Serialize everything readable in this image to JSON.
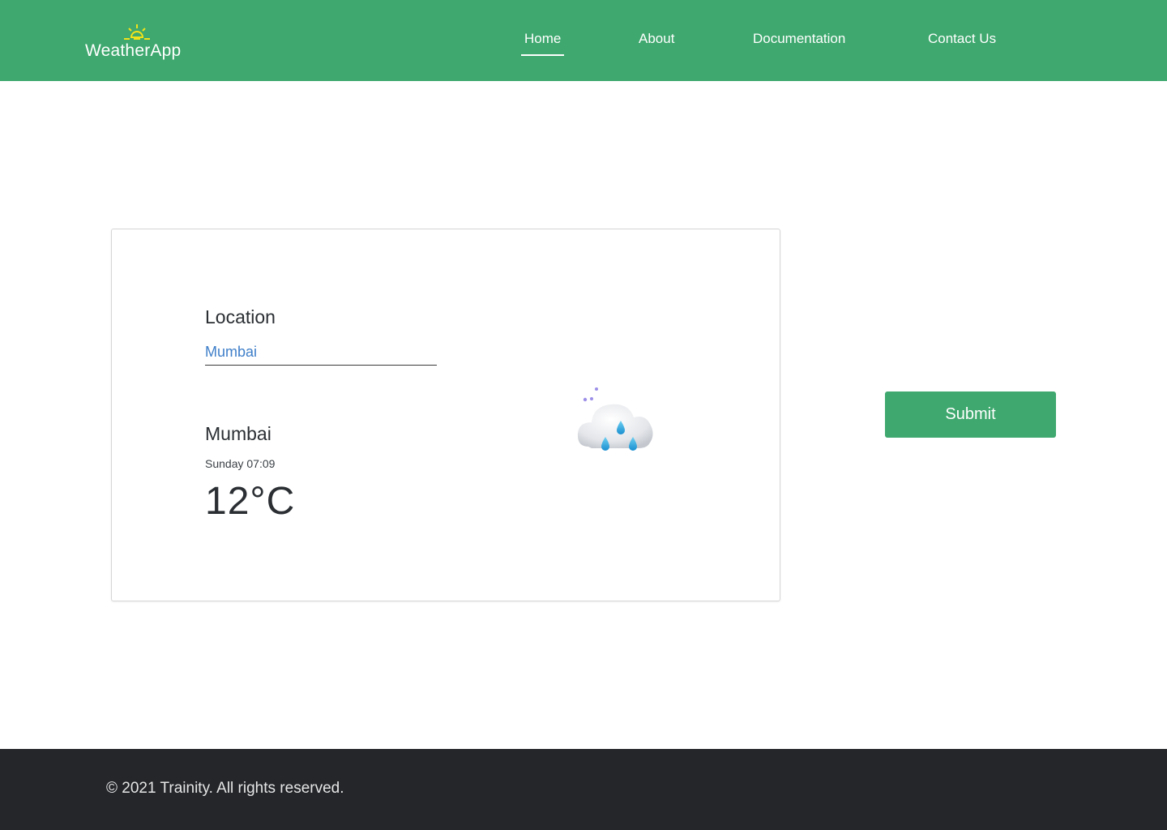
{
  "header": {
    "logo_text": "WeatherApp",
    "logo_icon": "sunrise-icon",
    "nav": [
      {
        "label": "Home",
        "active": true
      },
      {
        "label": "About",
        "active": false
      },
      {
        "label": "Documentation",
        "active": false
      },
      {
        "label": "Contact Us",
        "active": false
      }
    ]
  },
  "form": {
    "location_label": "Location",
    "location_value": "Mumbai"
  },
  "weather": {
    "city": "Mumbai",
    "datetime": "Sunday 07:09",
    "temperature": "12°C",
    "icon": "night-rain-cloud-icon"
  },
  "actions": {
    "submit_label": "Submit"
  },
  "footer": {
    "copyright": "© 2021 Trainity. All rights reserved."
  },
  "colors": {
    "brand_green": "#3ea86e",
    "footer_dark": "#24262a",
    "input_text_blue": "#3f7fc9",
    "logo_sun_yellow": "#f2e21a"
  }
}
